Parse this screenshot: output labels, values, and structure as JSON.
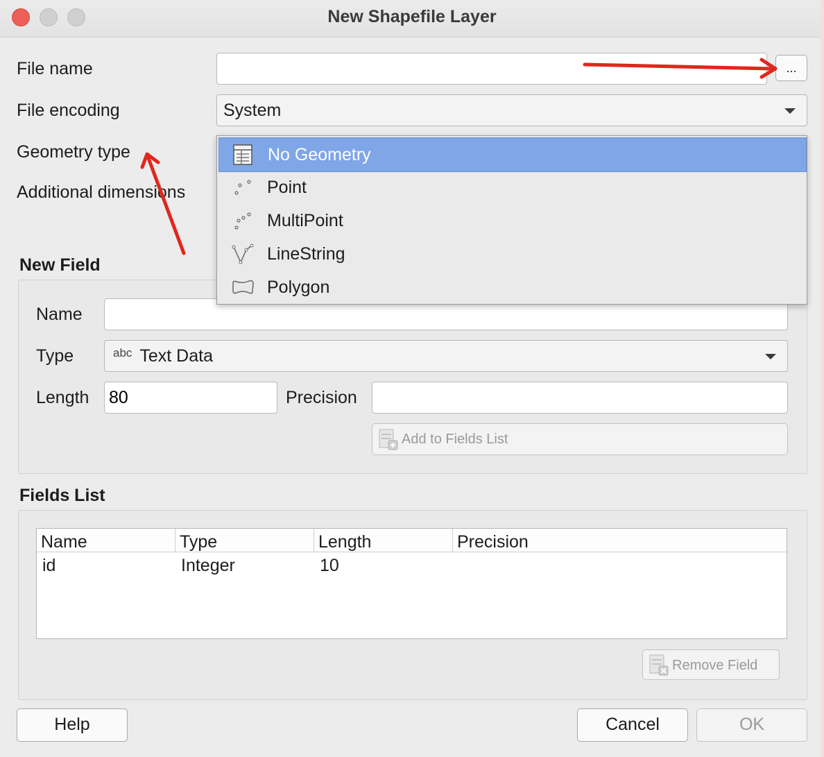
{
  "window": {
    "title": "New Shapefile Layer"
  },
  "form": {
    "file_name_label": "File name",
    "file_name_value": "",
    "browse_label": "...",
    "file_encoding_label": "File encoding",
    "file_encoding_value": "System",
    "geometry_type_label": "Geometry type",
    "additional_dimensions_label": "Additional dimensions"
  },
  "geometry_dropdown": {
    "items": [
      {
        "label": "No Geometry",
        "icon": "table-icon",
        "selected": true
      },
      {
        "label": "Point",
        "icon": "point-icon",
        "selected": false
      },
      {
        "label": "MultiPoint",
        "icon": "multipoint-icon",
        "selected": false
      },
      {
        "label": "LineString",
        "icon": "linestring-icon",
        "selected": false
      },
      {
        "label": "Polygon",
        "icon": "polygon-icon",
        "selected": false
      }
    ]
  },
  "new_field": {
    "section_title": "New Field",
    "name_label": "Name",
    "name_value": "",
    "type_label": "Type",
    "type_icon_text": "abc",
    "type_value": "Text Data",
    "length_label": "Length",
    "length_value": "80",
    "precision_label": "Precision",
    "precision_value": "",
    "add_button": "Add to Fields List"
  },
  "fields_list": {
    "section_title": "Fields List",
    "columns": [
      "Name",
      "Type",
      "Length",
      "Precision"
    ],
    "rows": [
      [
        "id",
        "Integer",
        "10",
        ""
      ]
    ],
    "remove_button": "Remove Field"
  },
  "footer": {
    "help": "Help",
    "cancel": "Cancel",
    "ok": "OK"
  },
  "colors": {
    "selection": "#7fa6e7",
    "annotation_arrow": "#e0271d",
    "close_button": "#ee5f58"
  }
}
